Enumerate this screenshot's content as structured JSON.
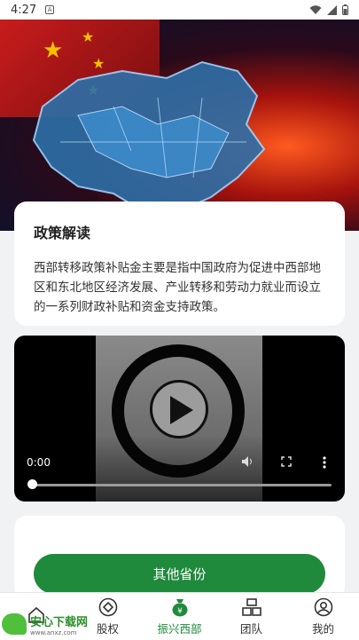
{
  "status_bar": {
    "time": "4:27",
    "badge": "A"
  },
  "policy": {
    "title": "政策解读",
    "body": "西部转移政策补贴金主要是指中国政府为促进中西部地区和东北地区经济发展、产业转移和劳动力就业而设立的一系列财政补贴和资金支持政策。"
  },
  "video": {
    "current_time": "0:00",
    "progress": 0
  },
  "actions": {
    "other_provinces_label": "其他省份"
  },
  "tabbar": {
    "items": [
      {
        "label": "",
        "icon": "home-icon",
        "active": false
      },
      {
        "label": "股权",
        "icon": "diamond-circle-icon",
        "active": false
      },
      {
        "label": "振兴西部",
        "icon": "money-bag-icon",
        "active": true
      },
      {
        "label": "团队",
        "icon": "team-blocks-icon",
        "active": false
      },
      {
        "label": "我的",
        "icon": "user-icon",
        "active": false
      }
    ]
  },
  "watermark": {
    "name": "安心下载网",
    "url": "www.anxz.com"
  },
  "colors": {
    "primary": "#1f8a3c",
    "background": "#f1f2f4"
  }
}
